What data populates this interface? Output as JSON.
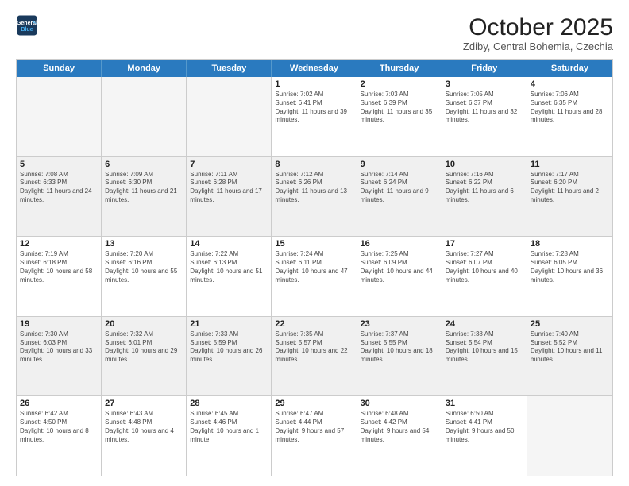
{
  "header": {
    "logo_line1": "General",
    "logo_line2": "Blue",
    "month_title": "October 2025",
    "location": "Zdiby, Central Bohemia, Czechia"
  },
  "days_of_week": [
    "Sunday",
    "Monday",
    "Tuesday",
    "Wednesday",
    "Thursday",
    "Friday",
    "Saturday"
  ],
  "rows": [
    [
      {
        "day": "",
        "text": ""
      },
      {
        "day": "",
        "text": ""
      },
      {
        "day": "",
        "text": ""
      },
      {
        "day": "1",
        "text": "Sunrise: 7:02 AM\nSunset: 6:41 PM\nDaylight: 11 hours and 39 minutes."
      },
      {
        "day": "2",
        "text": "Sunrise: 7:03 AM\nSunset: 6:39 PM\nDaylight: 11 hours and 35 minutes."
      },
      {
        "day": "3",
        "text": "Sunrise: 7:05 AM\nSunset: 6:37 PM\nDaylight: 11 hours and 32 minutes."
      },
      {
        "day": "4",
        "text": "Sunrise: 7:06 AM\nSunset: 6:35 PM\nDaylight: 11 hours and 28 minutes."
      }
    ],
    [
      {
        "day": "5",
        "text": "Sunrise: 7:08 AM\nSunset: 6:33 PM\nDaylight: 11 hours and 24 minutes."
      },
      {
        "day": "6",
        "text": "Sunrise: 7:09 AM\nSunset: 6:30 PM\nDaylight: 11 hours and 21 minutes."
      },
      {
        "day": "7",
        "text": "Sunrise: 7:11 AM\nSunset: 6:28 PM\nDaylight: 11 hours and 17 minutes."
      },
      {
        "day": "8",
        "text": "Sunrise: 7:12 AM\nSunset: 6:26 PM\nDaylight: 11 hours and 13 minutes."
      },
      {
        "day": "9",
        "text": "Sunrise: 7:14 AM\nSunset: 6:24 PM\nDaylight: 11 hours and 9 minutes."
      },
      {
        "day": "10",
        "text": "Sunrise: 7:16 AM\nSunset: 6:22 PM\nDaylight: 11 hours and 6 minutes."
      },
      {
        "day": "11",
        "text": "Sunrise: 7:17 AM\nSunset: 6:20 PM\nDaylight: 11 hours and 2 minutes."
      }
    ],
    [
      {
        "day": "12",
        "text": "Sunrise: 7:19 AM\nSunset: 6:18 PM\nDaylight: 10 hours and 58 minutes."
      },
      {
        "day": "13",
        "text": "Sunrise: 7:20 AM\nSunset: 6:16 PM\nDaylight: 10 hours and 55 minutes."
      },
      {
        "day": "14",
        "text": "Sunrise: 7:22 AM\nSunset: 6:13 PM\nDaylight: 10 hours and 51 minutes."
      },
      {
        "day": "15",
        "text": "Sunrise: 7:24 AM\nSunset: 6:11 PM\nDaylight: 10 hours and 47 minutes."
      },
      {
        "day": "16",
        "text": "Sunrise: 7:25 AM\nSunset: 6:09 PM\nDaylight: 10 hours and 44 minutes."
      },
      {
        "day": "17",
        "text": "Sunrise: 7:27 AM\nSunset: 6:07 PM\nDaylight: 10 hours and 40 minutes."
      },
      {
        "day": "18",
        "text": "Sunrise: 7:28 AM\nSunset: 6:05 PM\nDaylight: 10 hours and 36 minutes."
      }
    ],
    [
      {
        "day": "19",
        "text": "Sunrise: 7:30 AM\nSunset: 6:03 PM\nDaylight: 10 hours and 33 minutes."
      },
      {
        "day": "20",
        "text": "Sunrise: 7:32 AM\nSunset: 6:01 PM\nDaylight: 10 hours and 29 minutes."
      },
      {
        "day": "21",
        "text": "Sunrise: 7:33 AM\nSunset: 5:59 PM\nDaylight: 10 hours and 26 minutes."
      },
      {
        "day": "22",
        "text": "Sunrise: 7:35 AM\nSunset: 5:57 PM\nDaylight: 10 hours and 22 minutes."
      },
      {
        "day": "23",
        "text": "Sunrise: 7:37 AM\nSunset: 5:55 PM\nDaylight: 10 hours and 18 minutes."
      },
      {
        "day": "24",
        "text": "Sunrise: 7:38 AM\nSunset: 5:54 PM\nDaylight: 10 hours and 15 minutes."
      },
      {
        "day": "25",
        "text": "Sunrise: 7:40 AM\nSunset: 5:52 PM\nDaylight: 10 hours and 11 minutes."
      }
    ],
    [
      {
        "day": "26",
        "text": "Sunrise: 6:42 AM\nSunset: 4:50 PM\nDaylight: 10 hours and 8 minutes."
      },
      {
        "day": "27",
        "text": "Sunrise: 6:43 AM\nSunset: 4:48 PM\nDaylight: 10 hours and 4 minutes."
      },
      {
        "day": "28",
        "text": "Sunrise: 6:45 AM\nSunset: 4:46 PM\nDaylight: 10 hours and 1 minute."
      },
      {
        "day": "29",
        "text": "Sunrise: 6:47 AM\nSunset: 4:44 PM\nDaylight: 9 hours and 57 minutes."
      },
      {
        "day": "30",
        "text": "Sunrise: 6:48 AM\nSunset: 4:42 PM\nDaylight: 9 hours and 54 minutes."
      },
      {
        "day": "31",
        "text": "Sunrise: 6:50 AM\nSunset: 4:41 PM\nDaylight: 9 hours and 50 minutes."
      },
      {
        "day": "",
        "text": ""
      }
    ]
  ]
}
